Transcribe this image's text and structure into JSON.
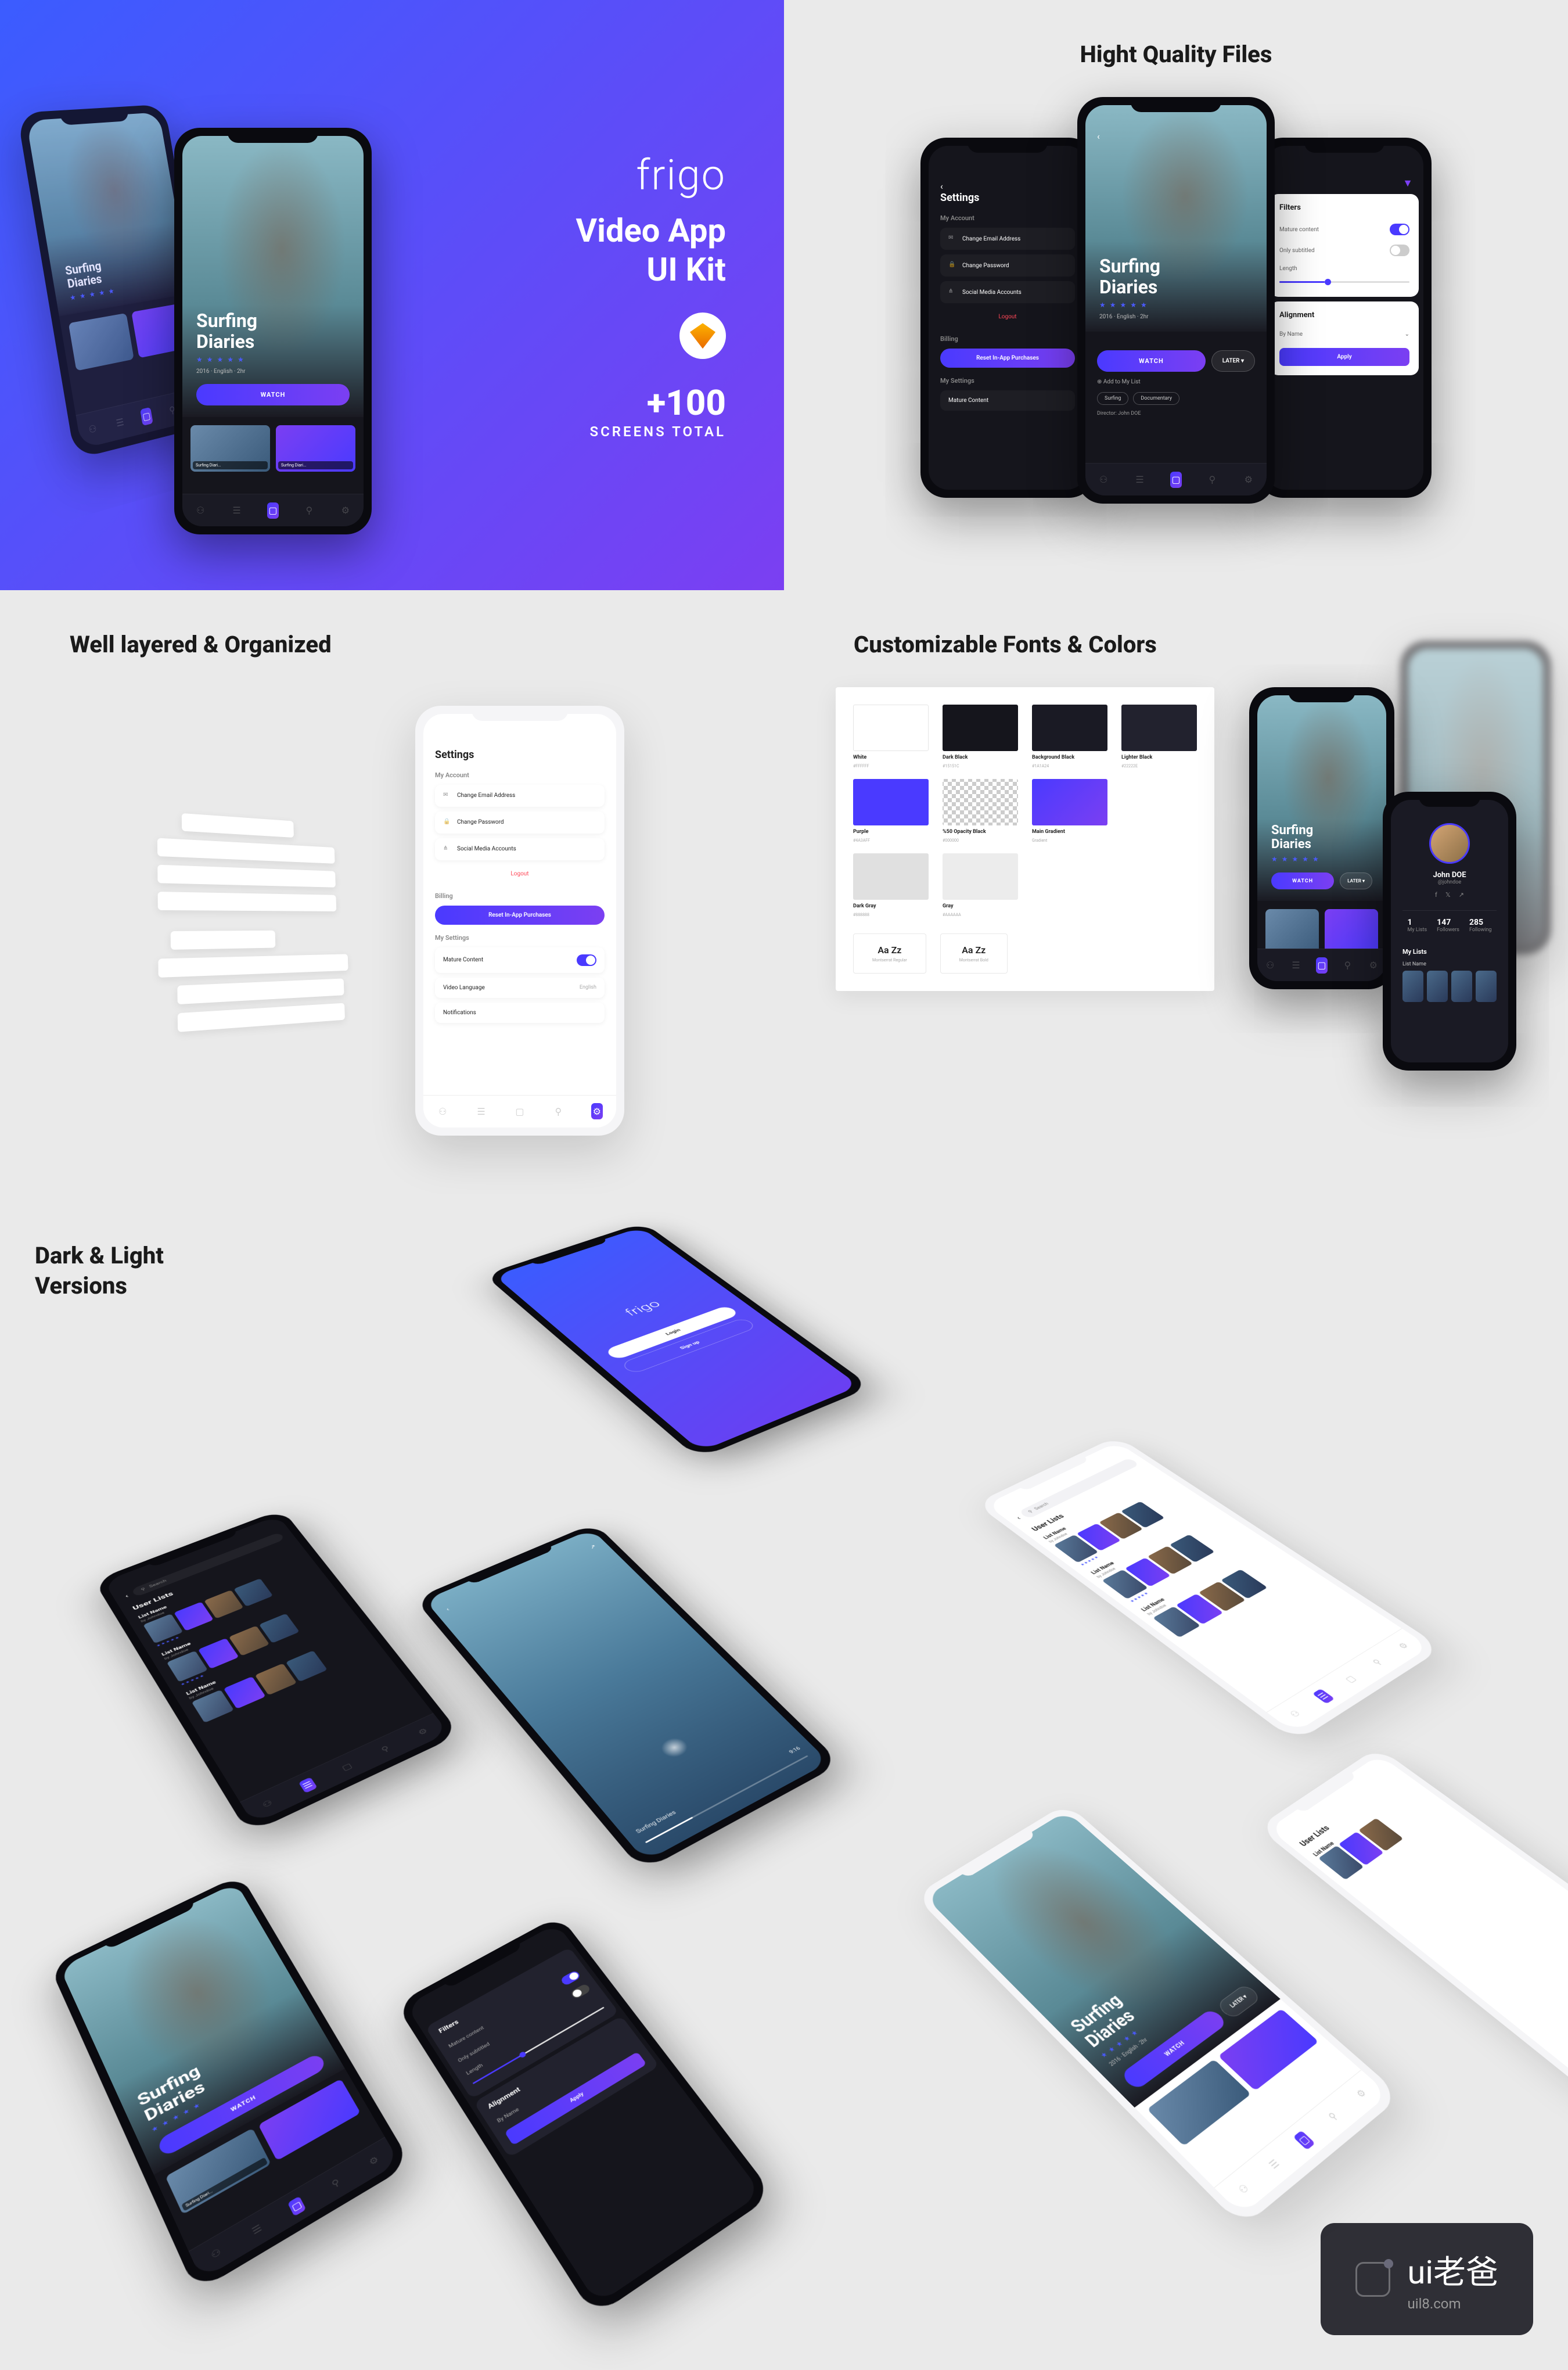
{
  "hero": {
    "logo": "frigo",
    "title_l1": "Video App",
    "title_l2": "UI Kit",
    "count": "+100",
    "sub": "SCREENS TOTAL"
  },
  "sections": {
    "quality": "Hight Quality Files",
    "layered": "Well layered & Organized",
    "custom": "Customizable Fonts & Colors",
    "darklight_l1": "Dark & Light",
    "darklight_l2": "Versions"
  },
  "surfing": {
    "title_l1": "Surfing",
    "title_l2": "Diaries",
    "stars": "★ ★ ★ ★ ★",
    "meta": "2016 · English · 2hr",
    "watch": "WATCH",
    "later": "LATER ▾",
    "addlist": "⊕ Add to My List",
    "tags": [
      "Surfing",
      "Documentary"
    ],
    "director": "Director: John DOE"
  },
  "settings": {
    "title": "Settings",
    "account": "My Account",
    "items_acc": [
      "Change Email Address",
      "Change Password",
      "Social Media Accounts"
    ],
    "logout": "Logout",
    "billing": "Billing",
    "reset": "Reset In-App Purchases",
    "mysettings": "My Settings",
    "mature": "Mature Content",
    "lang": "Video Language",
    "lang_val": "English",
    "notif": "Notifications"
  },
  "filters": {
    "title": "Filters",
    "mature": "Mature content",
    "subtitled": "Only subtitled",
    "length": "Length",
    "align_h": "Alignment",
    "align_v": "By Name",
    "apply": "Apply"
  },
  "swatches": [
    {
      "name": "White",
      "hex": "#FFFFFF",
      "color": "#ffffff",
      "border": "1px solid #e5e5e5"
    },
    {
      "name": "Dark Black",
      "hex": "#15151C",
      "color": "#15151c"
    },
    {
      "name": "Background Black",
      "hex": "#1A1A24",
      "color": "#1a1a24"
    },
    {
      "name": "Lighter Black",
      "hex": "#22222E",
      "color": "#22222e"
    },
    {
      "name": "Purple",
      "hex": "#4A3AFF",
      "color": "#4a3aff"
    },
    {
      "name": "%50 Opacity Black",
      "hex": "#000000",
      "color": "repeating-conic-gradient(#ccc 0% 25%,#fff 0% 50%) 50%/14px 14px"
    },
    {
      "name": "Main Gradient",
      "hex": "Gradient",
      "color": "linear-gradient(135deg,#4a3aff,#7b3ff2)"
    },
    {
      "name": "",
      "hex": "",
      "color": "transparent"
    },
    {
      "name": "Dark Gray",
      "hex": "#888888",
      "color": "#e0e0e0"
    },
    {
      "name": "Gray",
      "hex": "#AAAAAA",
      "color": "#ececec"
    }
  ],
  "fonts": [
    {
      "sample": "Aa Zz",
      "name": "Montserrat Regular"
    },
    {
      "sample": "Aa Zz",
      "name": "Montserrat Bold"
    }
  ],
  "profile": {
    "name": "John DOE",
    "user": "@johndoe",
    "stats": [
      {
        "n": "1",
        "l": "My Lists"
      },
      {
        "n": "147",
        "l": "Followers"
      },
      {
        "n": "285",
        "l": "Following"
      }
    ],
    "mylists": "My Lists",
    "listname": "List Name"
  },
  "userlists": {
    "title": "User Lists",
    "search": "Search",
    "items": [
      {
        "name": "List Name",
        "by": "by Johndoe"
      },
      {
        "name": "List Name",
        "by": "by Johndoe"
      },
      {
        "name": "List Name",
        "by": "by Johndoe"
      }
    ],
    "stars": "★★★★★"
  },
  "login": {
    "logo": "frigo",
    "login": "Login",
    "signup": "Sign up"
  },
  "player": {
    "title": "Surfing Diaries",
    "time": "9:16"
  },
  "thumbstrip": {
    "label": "Surfing Diari..."
  },
  "watermark": {
    "text": "ui老爸",
    "url": "uil8.com"
  }
}
